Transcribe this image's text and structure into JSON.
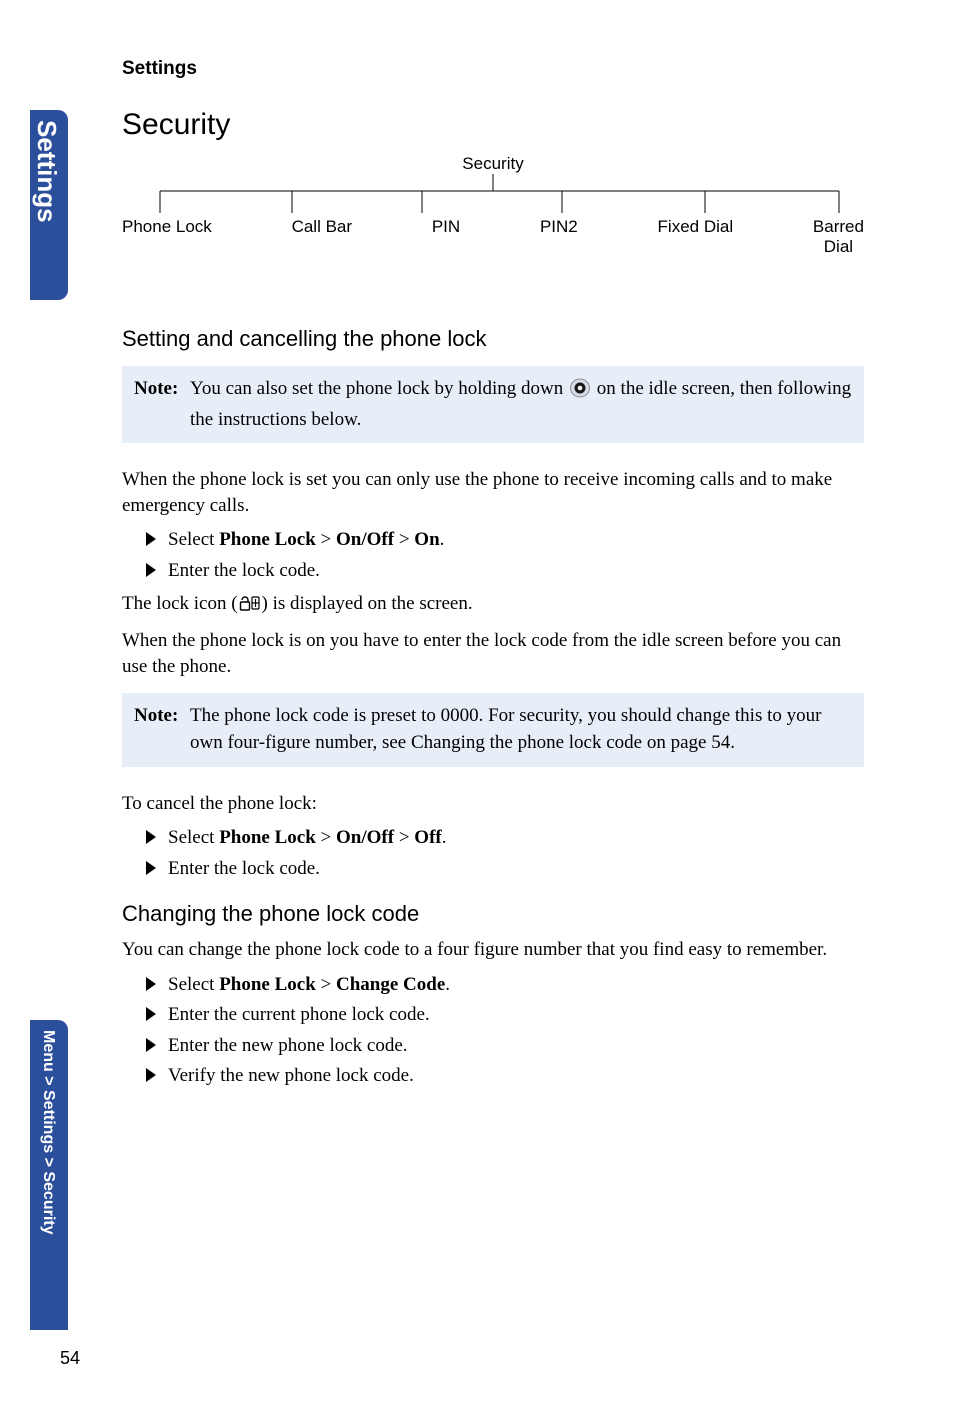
{
  "header": {
    "section": "Settings"
  },
  "sidebar": {
    "tab1": "Settings",
    "tab2": "Menu > Settings > Security"
  },
  "h1": "Security",
  "diagram": {
    "root": "Security",
    "children": [
      "Phone Lock",
      "Call Bar",
      "PIN",
      "PIN2",
      "Fixed Dial",
      "Barred\nDial"
    ]
  },
  "sec1": {
    "title": "Setting and cancelling the phone lock",
    "note1_label": "Note:",
    "note1_a": "You can also set the phone lock by holding down ",
    "note1_b": " on the idle screen, then following the instructions below.",
    "p1": "When the phone lock is set you can only use the phone to receive incoming calls and to make emergency calls.",
    "b1_pre": "Select ",
    "b1_s1": "Phone Lock",
    "b1_gt1": " > ",
    "b1_s2": "On/Off",
    "b1_gt2": " > ",
    "b1_s3": "On",
    "b1_post": ".",
    "b2": "Enter the lock code.",
    "p2a": "The lock icon (",
    "p2b": ") is displayed on the screen.",
    "p3": "When the phone lock is on you have to enter the lock code from the idle screen before you can use the phone.",
    "note2_label": "Note:",
    "note2": "The phone lock code is preset to 0000. For security, you should change this to your own four-figure number, see Changing the phone lock code on page 54.",
    "p4": "To cancel the phone lock:",
    "b3_pre": "Select ",
    "b3_s1": "Phone Lock",
    "b3_gt1": " > ",
    "b3_s2": "On/Off",
    "b3_gt2": " > ",
    "b3_s3": "Off",
    "b3_post": ".",
    "b4": "Enter the lock code."
  },
  "sec2": {
    "title": "Changing the phone lock code",
    "p1": "You can change the phone lock code to a four figure number that you find easy to remember.",
    "b1_pre": "Select ",
    "b1_s1": "Phone Lock",
    "b1_gt1": " > ",
    "b1_s2": "Change Code",
    "b1_post": ".",
    "b2": "Enter the current phone lock code.",
    "b3": "Enter the new phone lock code.",
    "b4": "Verify the new phone lock code."
  },
  "page_number": "54"
}
